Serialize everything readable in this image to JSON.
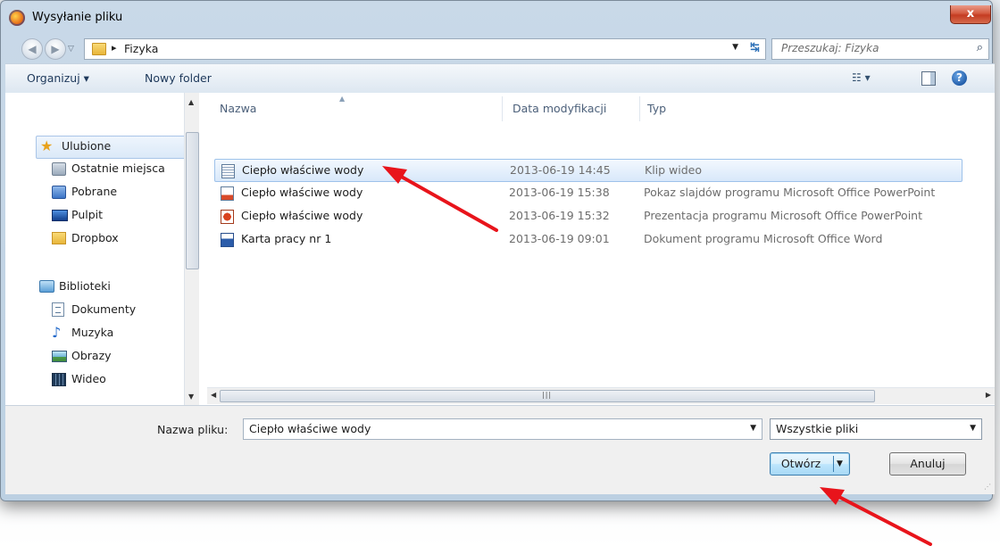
{
  "dialog": {
    "title": "Wysyłanie pliku",
    "close_label": "x"
  },
  "address": {
    "path": "Fizyka",
    "search_placeholder": "Przeszukaj: Fizyka"
  },
  "toolbar": {
    "organize_label": "Organizuj ▾",
    "new_folder_label": "Nowy folder",
    "view_label": "☷ ▾",
    "help_label": "?"
  },
  "sidebar": {
    "favorites": [
      {
        "label": "Ulubione",
        "icon": "star-icon"
      },
      {
        "label": "Ostatnie miejsca",
        "icon": "recent-places-icon"
      },
      {
        "label": "Pobrane",
        "icon": "downloads-icon"
      },
      {
        "label": "Pulpit",
        "icon": "desktop-icon"
      },
      {
        "label": "Dropbox",
        "icon": "folder-icon"
      }
    ],
    "libraries": [
      {
        "label": "Biblioteki",
        "icon": "libraries-icon"
      },
      {
        "label": "Dokumenty",
        "icon": "documents-icon"
      },
      {
        "label": "Muzyka",
        "icon": "music-icon"
      },
      {
        "label": "Obrazy",
        "icon": "pictures-icon"
      },
      {
        "label": "Wideo",
        "icon": "video-icon"
      }
    ]
  },
  "file_list": {
    "columns": [
      "Nazwa",
      "Data modyfikacji",
      "Typ"
    ],
    "rows": [
      {
        "name": "Ciepło właściwe wody",
        "date": "2013-06-19 14:45",
        "type": "Klip wideo",
        "icon": "video-file-icon",
        "selected": true
      },
      {
        "name": "Ciepło właściwe wody",
        "date": "2013-06-19 15:38",
        "type": "Pokaz slajdów programu Microsoft Office PowerPoint",
        "icon": "powerpoint-show-icon",
        "selected": false
      },
      {
        "name": "Ciepło właściwe wody",
        "date": "2013-06-19 15:32",
        "type": "Prezentacja programu Microsoft Office PowerPoint",
        "icon": "powerpoint-file-icon",
        "selected": false
      },
      {
        "name": "Karta pracy nr 1",
        "date": "2013-06-19 09:01",
        "type": "Dokument programu Microsoft Office Word",
        "icon": "word-file-icon",
        "selected": false
      }
    ]
  },
  "footer": {
    "filename_label": "Nazwa pliku:",
    "filename_value": "Ciepło właściwe wody",
    "filetype_value": "Wszystkie pliki",
    "open_label": "Otwórz",
    "cancel_label": "Anuluj"
  },
  "colors": {
    "annotation_arrow": "#e8141b",
    "selection": "#d8e8fa",
    "close_button": "#c43b21"
  }
}
